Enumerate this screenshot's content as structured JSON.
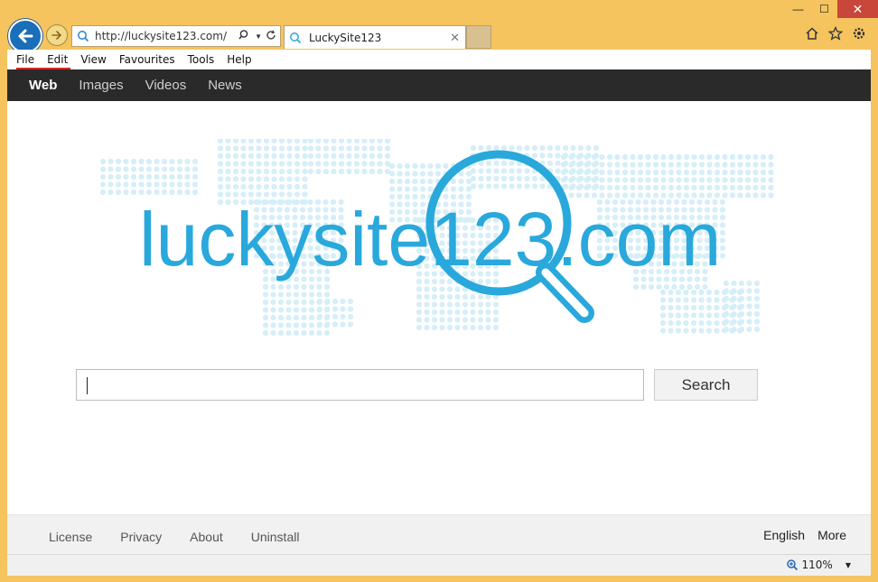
{
  "browser": {
    "address": "http://luckysite123.com/",
    "tab_title": "LuckySite123",
    "tab_close": "✕",
    "menu": [
      "File",
      "Edit",
      "View",
      "Favourites",
      "Tools",
      "Help"
    ],
    "window_controls": {
      "minimize": "—",
      "maximize": "☐",
      "close": "✕"
    },
    "zoom": "110%"
  },
  "site": {
    "nav": [
      "Web",
      "Images",
      "Videos",
      "News"
    ],
    "active_nav": "Web",
    "logo_text_left": "luckysite",
    "logo_text_mid": "123",
    "logo_text_right": ".com",
    "search_value": "",
    "search_button": "Search",
    "footer_links": [
      "License",
      "Privacy",
      "About",
      "Uninstall"
    ],
    "footer_right": [
      "English",
      "More"
    ]
  },
  "colors": {
    "frame": "#f5c45f",
    "brand": "#29a8dc",
    "map_dots": "#d6eef7",
    "nav_bg": "#2a2a2a"
  }
}
